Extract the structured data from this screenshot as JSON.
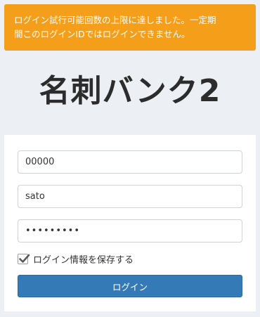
{
  "alert": {
    "line1": "ログイン試行可能回数の上限に達しました。一定期",
    "line2": "間このログインIDではログインできません。"
  },
  "logo": {
    "text": "名刺バンク2"
  },
  "form": {
    "company_value": "00000",
    "user_value": "sato",
    "password_value": "passwordx",
    "remember_label": "ログイン情報を保存する",
    "remember_checked": true,
    "login_label": "ログイン"
  },
  "colors": {
    "alert_bg": "#f49e19",
    "button_bg": "#337ab7",
    "page_bg": "#eceff3"
  }
}
